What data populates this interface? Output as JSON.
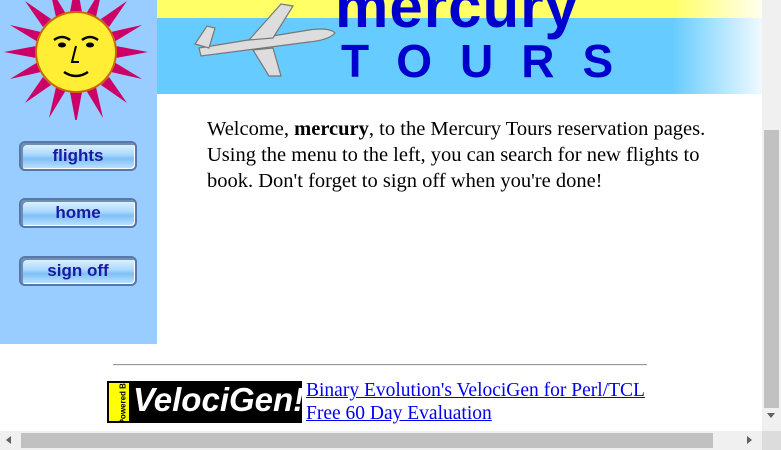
{
  "header": {
    "logo_word": "mercury",
    "logo_sub": "TOURS"
  },
  "nav": {
    "flights": "flights",
    "home": "home",
    "sign_off": "sign off"
  },
  "welcome": {
    "prefix": "Welcome, ",
    "username": "mercury",
    "suffix": ", to the Mercury Tours reservation pages. Using the menu to the left, you can search for new flights to book. Don't forget to sign off when you're done!"
  },
  "footer": {
    "badge_powered": "Powered By",
    "badge_brand": "VelociGen!",
    "ad_line1": "Binary Evolution's VelociGen for Perl/TCL",
    "ad_line2": "Free 60 Day Evaluation"
  },
  "colors": {
    "sidebar": "#99ccff",
    "banner_yellow": "#ffff66",
    "banner_blue": "#66ccff",
    "logo": "#0000cc",
    "link": "#0000ee"
  }
}
